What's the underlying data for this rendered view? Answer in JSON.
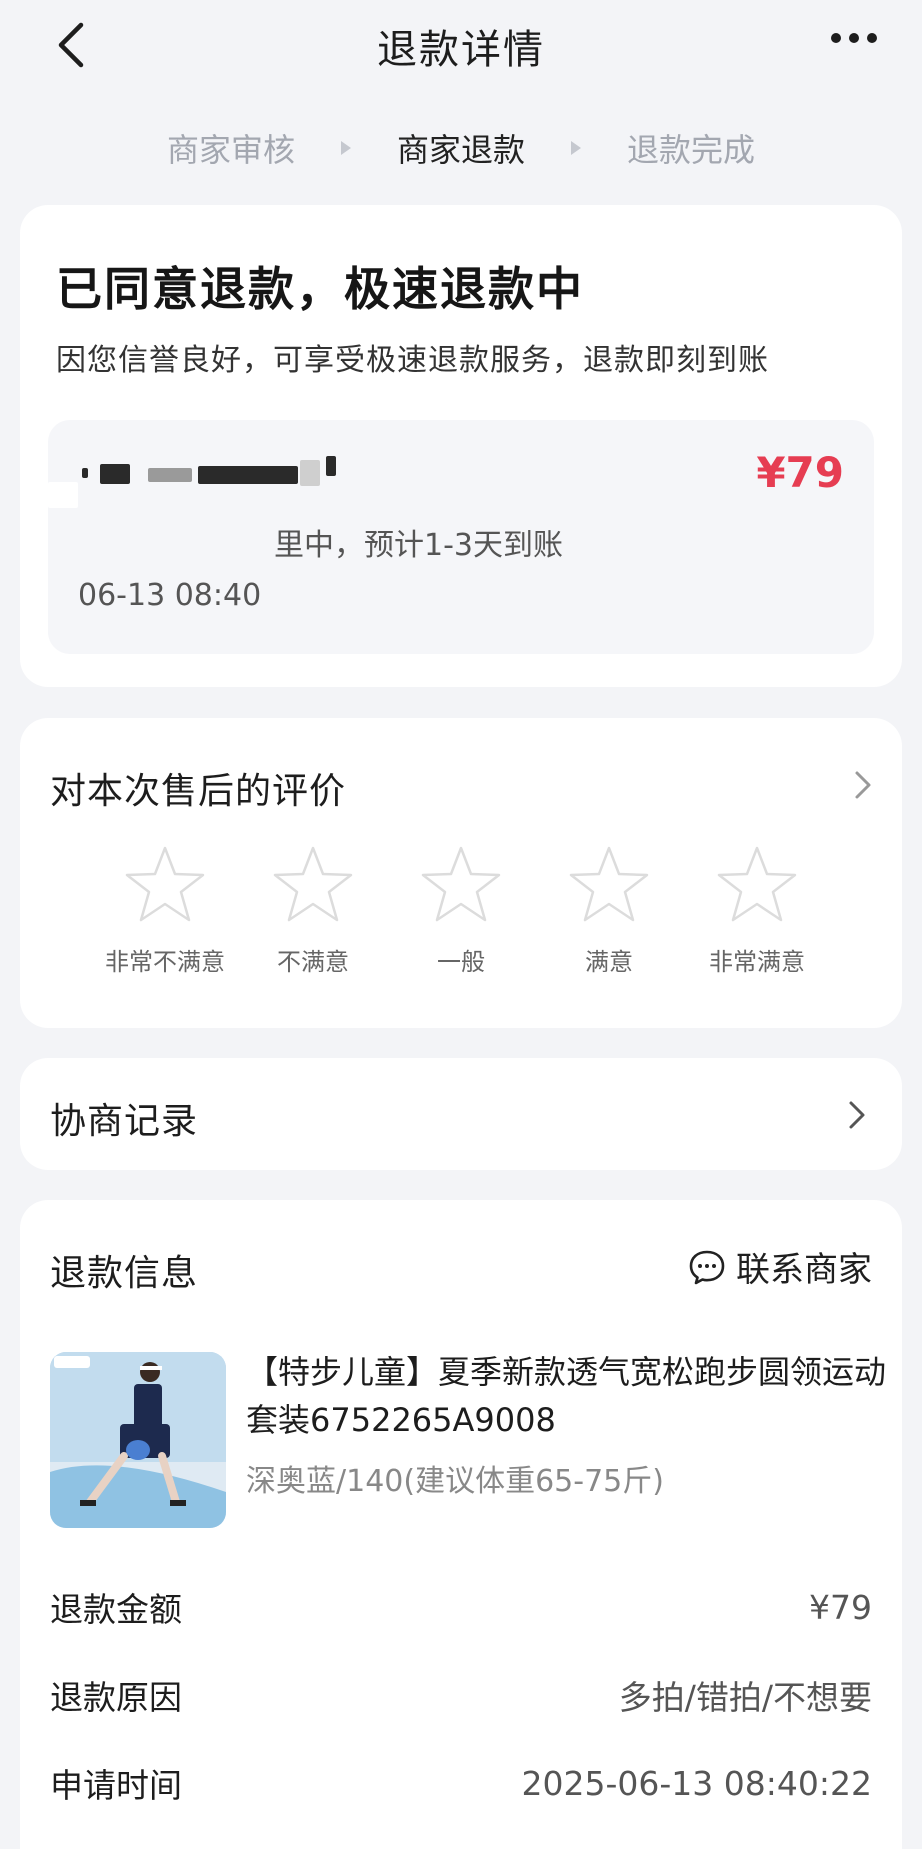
{
  "header": {
    "title": "退款详情"
  },
  "steps": {
    "items": [
      {
        "label": "商家审核",
        "active": false
      },
      {
        "label": "商家退款",
        "active": true
      },
      {
        "label": "退款完成",
        "active": false
      }
    ]
  },
  "status": {
    "title": "已同意退款，极速退款中",
    "description": "因您信誉良好，可享受极速退款服务，退款即刻到账",
    "amount": "¥79",
    "processing_text": "里中，预计1-3天到账",
    "time": "06-13 08:40"
  },
  "review": {
    "title": "对本次售后的评价",
    "ratings": [
      "非常不满意",
      "不满意",
      "一般",
      "满意",
      "非常满意"
    ],
    "selected_stars": 0
  },
  "negotiation": {
    "title": "协商记录"
  },
  "refund_info": {
    "title": "退款信息",
    "contact_label": "联系商家",
    "product": {
      "name": "【特步儿童】夏季新款透气宽松跑步圆领运动套装6752265A9008",
      "spec": "深奥蓝/140(建议体重65-75斤)"
    },
    "rows": [
      {
        "label": "退款金额",
        "value": "¥79"
      },
      {
        "label": "退款原因",
        "value": "多拍/错拍/不想要"
      },
      {
        "label": "申请时间",
        "value": "2025-06-13 08:40:22"
      }
    ]
  },
  "colors": {
    "accent_red": "#e63d52",
    "background": "#f3f4f7",
    "card": "#ffffff"
  }
}
